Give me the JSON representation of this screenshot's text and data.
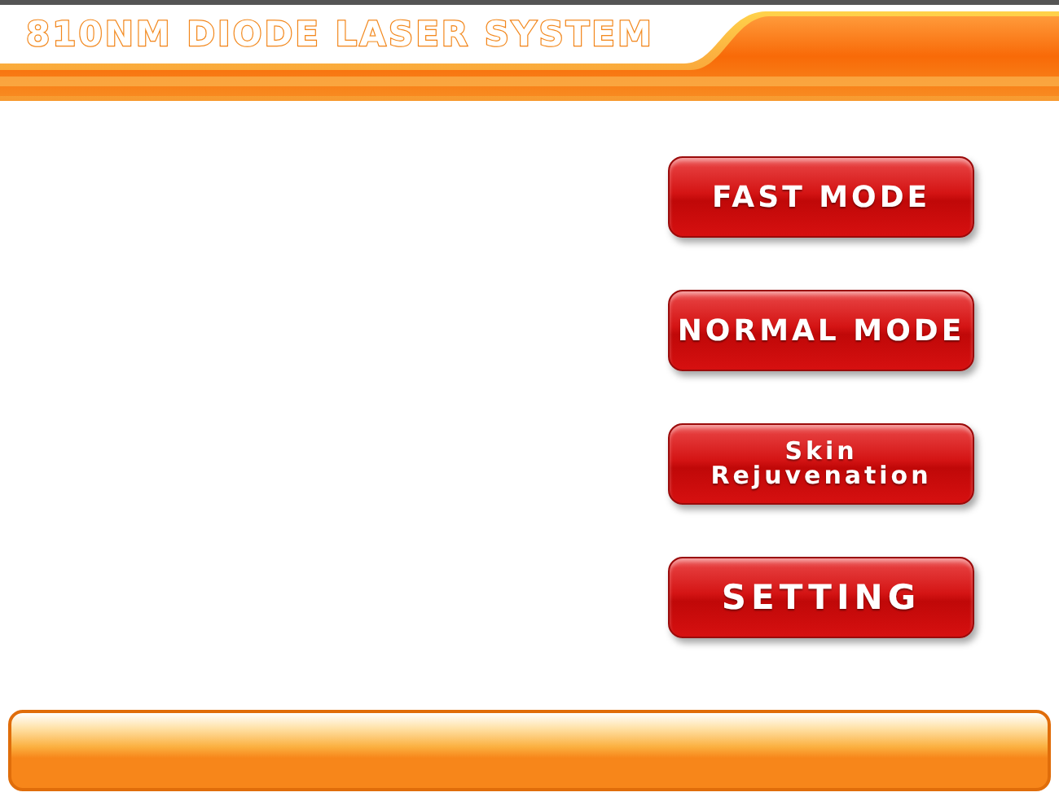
{
  "header": {
    "title": "810NM DIODE LASER SYSTEM"
  },
  "menu": [
    {
      "label": "FAST MODE",
      "kind": "single"
    },
    {
      "label": "NORMAL MODE",
      "kind": "single"
    },
    {
      "label": "Skin Rejuvenation",
      "kind": "double"
    },
    {
      "label": "SETTING",
      "kind": "large"
    }
  ]
}
